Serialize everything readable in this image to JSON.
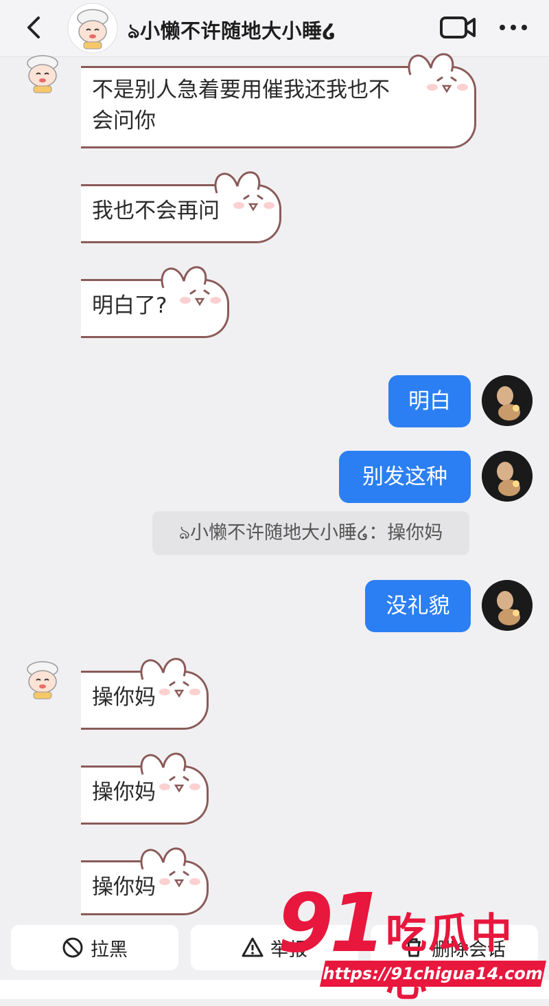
{
  "header": {
    "title": "ঌ小懒不许随地大小睡໒"
  },
  "messages": [
    {
      "side": "in",
      "text_line1": "不是别人急着要用催我还我也不",
      "text_line2": "会问你"
    },
    {
      "side": "in",
      "text": "我也不会再问"
    },
    {
      "side": "in",
      "text": "明白了?"
    },
    {
      "side": "out",
      "text": "明白"
    },
    {
      "side": "out",
      "text": "别发这种"
    },
    {
      "side": "notice",
      "text": "ঌ小懒不许随地大小睡໒：操你妈"
    },
    {
      "side": "out",
      "text": "没礼貌"
    },
    {
      "side": "in",
      "text": "操你妈"
    },
    {
      "side": "in",
      "text": "操你妈"
    },
    {
      "side": "in",
      "text": "操你妈"
    }
  ],
  "actions": {
    "block": "拉黑",
    "report": "举报",
    "delete": "删除会话"
  },
  "watermark": {
    "number": "91",
    "text": "吃瓜中心",
    "url": "https://91chigua14.com"
  },
  "colors": {
    "outgoing_bubble": "#2c7ff2",
    "bubble_outline": "#8a5a58",
    "background": "#f0f0f2",
    "watermark": "#e8173d"
  }
}
